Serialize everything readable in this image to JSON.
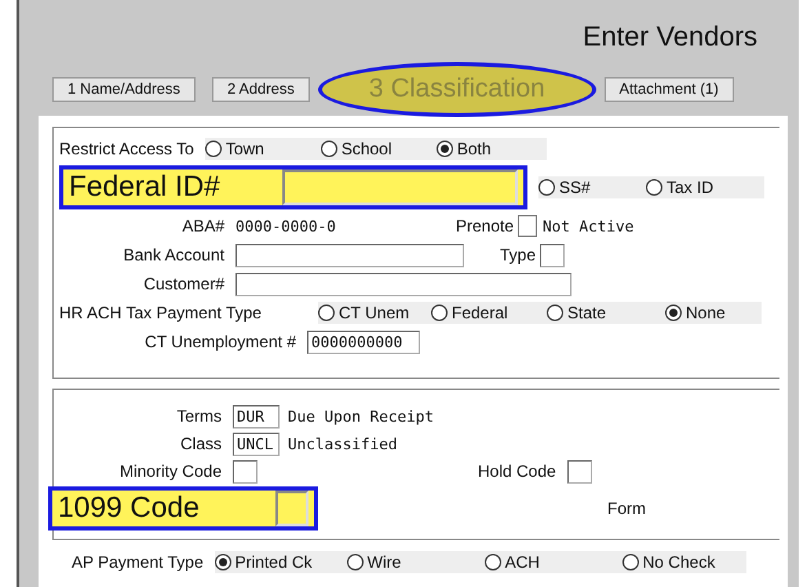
{
  "window": {
    "title": "Enter Vendors"
  },
  "tabs": [
    {
      "label": "1 Name/Address",
      "selected": false
    },
    {
      "label": "2 Address",
      "selected": false
    },
    {
      "label": "3 Classification",
      "selected": true
    },
    {
      "label": "Attachment (1)",
      "selected": false
    }
  ],
  "restrict_access": {
    "label": "Restrict Access To",
    "options": [
      {
        "label": "Town",
        "selected": false
      },
      {
        "label": "School",
        "selected": false
      },
      {
        "label": "Both",
        "selected": true
      }
    ]
  },
  "federal_id": {
    "label": "Federal ID#",
    "options": [
      {
        "label": "SS#",
        "selected": false
      },
      {
        "label": "Tax ID",
        "selected": false
      }
    ]
  },
  "aba": {
    "label": "ABA#",
    "value": "0000-0000-0"
  },
  "prenote": {
    "label": "Prenote",
    "checked": false,
    "status": "Not Active"
  },
  "bank_account": {
    "label": "Bank Account"
  },
  "account_type": {
    "label": "Type"
  },
  "customer": {
    "label": "Customer#"
  },
  "hr_ach": {
    "label": "HR ACH Tax Payment Type",
    "options": [
      {
        "label": "CT Unem",
        "selected": false
      },
      {
        "label": "Federal",
        "selected": false
      },
      {
        "label": "State",
        "selected": false
      },
      {
        "label": "None",
        "selected": true
      }
    ]
  },
  "ct_unemployment": {
    "label": "CT Unemployment #",
    "value": "0000000000"
  },
  "terms": {
    "label": "Terms",
    "code": "DUR",
    "description": "Due Upon Receipt"
  },
  "class": {
    "label": "Class",
    "code": "UNCL",
    "description": "Unclassified"
  },
  "minority_code": {
    "label": "Minority Code"
  },
  "hold_code": {
    "label": "Hold Code"
  },
  "code_1099": {
    "label": "1099 Code"
  },
  "form": {
    "label": "Form"
  },
  "ap_payment_type": {
    "label": "AP Payment Type",
    "options": [
      {
        "label": "Printed Ck",
        "selected": true
      },
      {
        "label": "Wire",
        "selected": false
      },
      {
        "label": "ACH",
        "selected": false
      },
      {
        "label": "No Check",
        "selected": false
      }
    ]
  }
}
